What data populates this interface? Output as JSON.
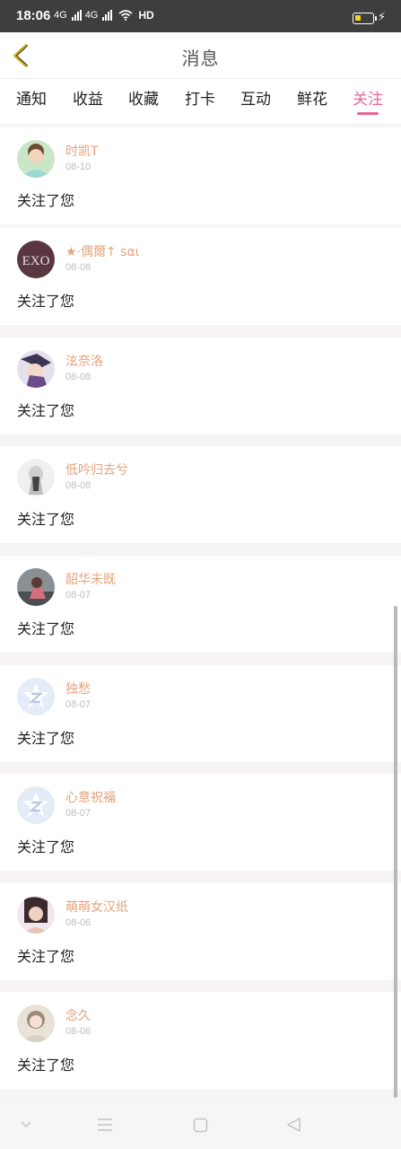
{
  "status_bar": {
    "time": "18:06",
    "signal1": "4G",
    "signal2": "4G",
    "network": "HD",
    "battery_level": 0.35
  },
  "header": {
    "title": "消息"
  },
  "tabs": [
    {
      "label": "通知",
      "active": false
    },
    {
      "label": "收益",
      "active": false
    },
    {
      "label": "收藏",
      "active": false
    },
    {
      "label": "打卡",
      "active": false
    },
    {
      "label": "互动",
      "active": false
    },
    {
      "label": "鲜花",
      "active": false
    },
    {
      "label": "关注",
      "active": true
    }
  ],
  "colors": {
    "accent": "#e8669a",
    "username": "#e6a27a",
    "back_arrow": "#c9a817"
  },
  "items": [
    {
      "name": "时凯T",
      "date": "08-10",
      "message": "关注了您"
    },
    {
      "name": "★·偶爾↑ sαι",
      "date": "08-08",
      "message": "关注了您"
    },
    {
      "name": "泫奈洛",
      "date": "08-08",
      "message": "关注了您"
    },
    {
      "name": "低吟归去兮",
      "date": "08-08",
      "message": "关注了您"
    },
    {
      "name": "韶华未既",
      "date": "08-07",
      "message": "关注了您"
    },
    {
      "name": "独愁",
      "date": "08-07",
      "message": "关注了您"
    },
    {
      "name": "心意祝福",
      "date": "08-07",
      "message": "关注了您"
    },
    {
      "name": "萌萌女汉纸",
      "date": "08-06",
      "message": "关注了您"
    },
    {
      "name": "念久",
      "date": "08-06",
      "message": "关注了您"
    }
  ],
  "avatar_badge": "EXO",
  "system_nav": {
    "icons": [
      "chevron-down-icon",
      "menu-icon",
      "home-square-icon",
      "back-triangle-icon"
    ]
  }
}
